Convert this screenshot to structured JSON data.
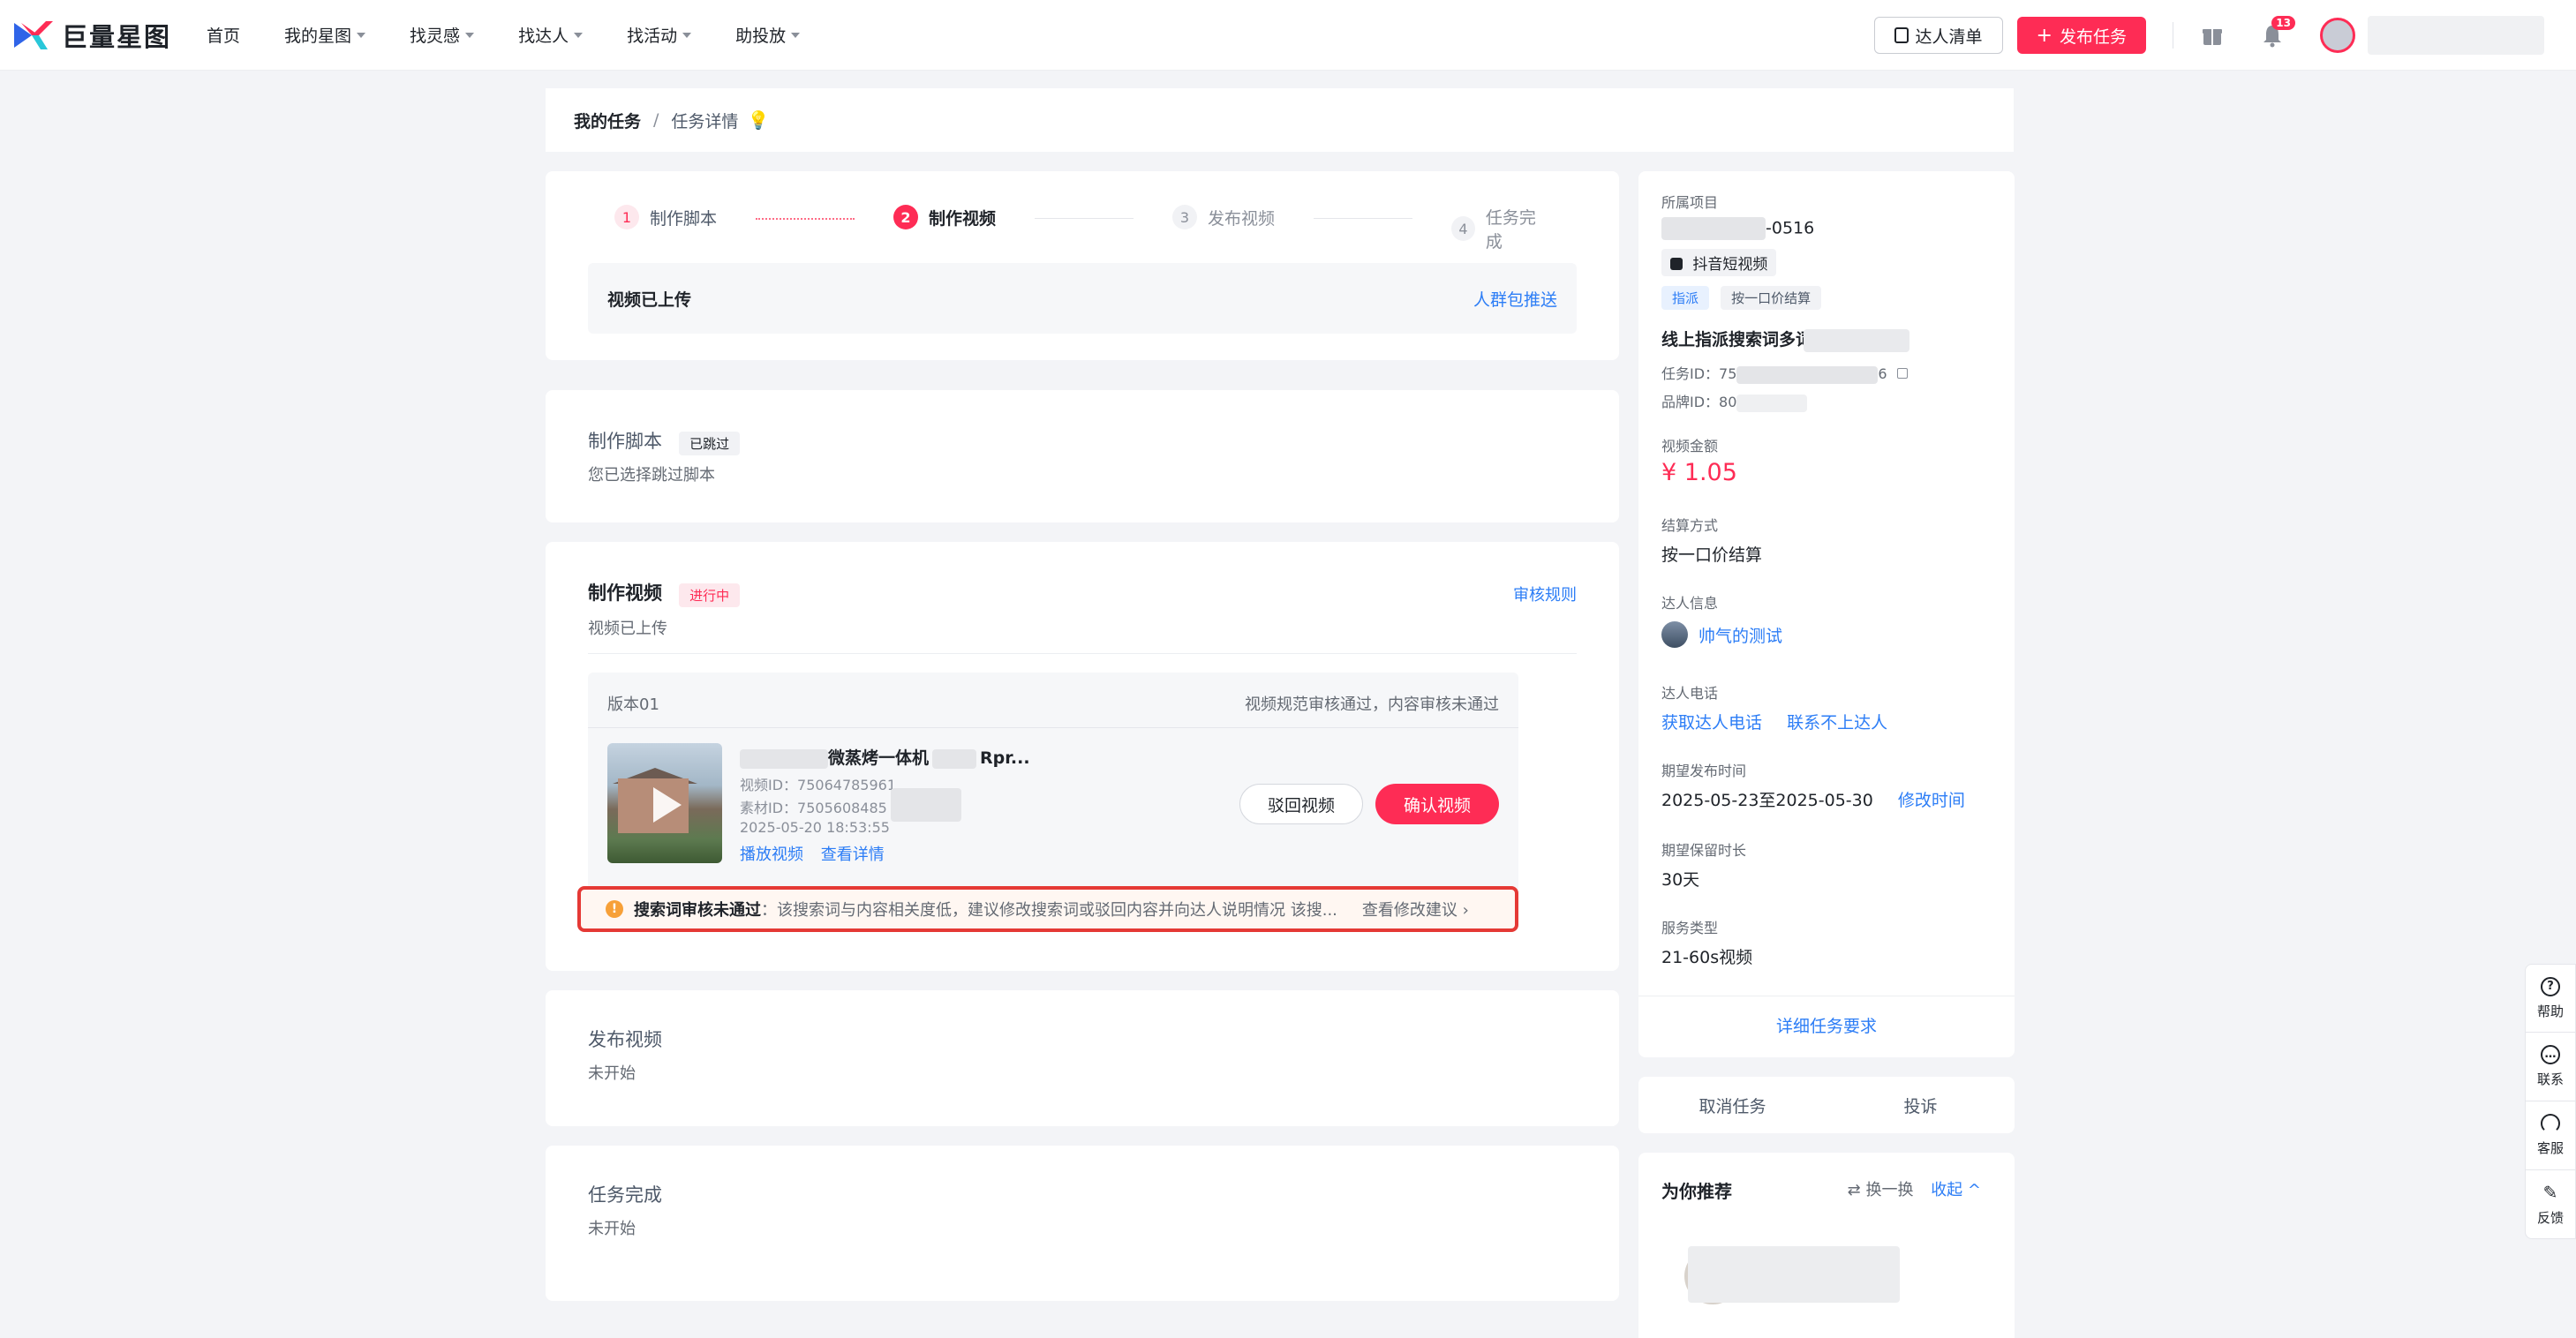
{
  "navbar": {
    "brand": "巨量星图",
    "items": [
      "首页",
      "我的星图",
      "找灵感",
      "找达人",
      "找活动",
      "助投放"
    ],
    "talent_list_label": "达人清单",
    "publish_label": "发布任务",
    "notification_count": "13"
  },
  "breadcrumb": {
    "parent": "我的任务",
    "separator": "/",
    "current": "任务详情"
  },
  "steps": [
    {
      "num": "1",
      "label": "制作脚本"
    },
    {
      "num": "2",
      "label": "制作视频"
    },
    {
      "num": "3",
      "label": "发布视频"
    },
    {
      "num": "4",
      "label": "任务完成"
    }
  ],
  "status_bar": {
    "text": "视频已上传",
    "link": "人群包推送"
  },
  "script_section": {
    "title": "制作脚本",
    "tag": "已跳过",
    "desc": "您已选择跳过脚本"
  },
  "video_section": {
    "title": "制作视频",
    "tag": "进行中",
    "rules_link": "审核规则",
    "desc": "视频已上传",
    "version": {
      "label": "版本01",
      "status": "视频规范审核通过，内容审核未通过",
      "title_mid": "微蒸烤一体机",
      "title_end": "Rpr...",
      "video_id_label": "视频ID：",
      "video_id": "75064785961",
      "material_id_label": "素材ID：",
      "material_id": "7505608485",
      "datetime": "2025-05-20 18:53:55",
      "play_link": "播放视频",
      "detail_link": "查看详情",
      "reject_button": "驳回视频",
      "confirm_button": "确认视频"
    },
    "warning": {
      "title": "搜索词审核未通过",
      "text": "：该搜索词与内容相关度低，建议修改搜索词或驳回内容并向达人说明情况 该搜...",
      "link": "查看修改建议"
    }
  },
  "publish_section": {
    "title": "发布视频",
    "desc": "未开始"
  },
  "complete_section": {
    "title": "任务完成",
    "desc": "未开始"
  },
  "sidebar": {
    "project_label": "所属项目",
    "project_suffix": "-0516",
    "platform": "抖音短视频",
    "tags": [
      "指派",
      "按一口价结算"
    ],
    "task_name": "线上指派搜索词多词2机审核",
    "task_id_label": "任务ID：",
    "task_id_prefix": "75",
    "task_id_suffix": "6",
    "brand_id_label": "品牌ID：",
    "brand_id_prefix": "80",
    "video_amount_label": "视频金额",
    "video_amount": "¥ 1.05",
    "settlement_label": "结算方式",
    "settlement": "按一口价结算",
    "talent_info_label": "达人信息",
    "talent_name": "帅气的测试",
    "talent_phone_label": "达人电话",
    "get_phone_link": "获取达人电话",
    "cannot_contact_link": "联系不上达人",
    "expected_publish_label": "期望发布时间",
    "expected_publish": "2025-05-23至2025-05-30",
    "modify_time_link": "修改时间",
    "retention_label": "期望保留时长",
    "retention": "30天",
    "service_type_label": "服务类型",
    "service_type": "21-60s视频",
    "details_link": "详细任务要求",
    "cancel_task": "取消任务",
    "complain": "投诉",
    "recommend_title": "为你推荐",
    "refresh_label": "换一换",
    "collapse_label": "收起"
  },
  "floating": [
    "帮助",
    "联系",
    "客服",
    "反馈"
  ],
  "colors": {
    "accent": "#fe2c55",
    "link": "#2c7df6",
    "warning_border": "#e53935"
  }
}
